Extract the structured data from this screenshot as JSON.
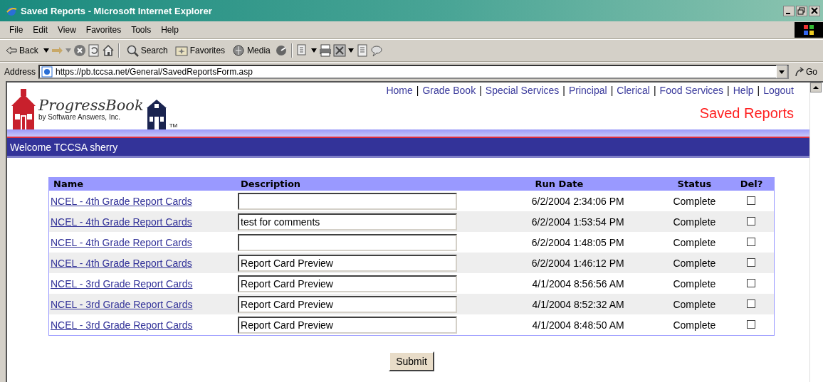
{
  "window": {
    "title": "Saved Reports - Microsoft Internet Explorer"
  },
  "menu": [
    "File",
    "Edit",
    "View",
    "Favorites",
    "Tools",
    "Help"
  ],
  "toolbar": {
    "back": "Back",
    "search": "Search",
    "favorites": "Favorites",
    "media": "Media"
  },
  "address_bar": {
    "label": "Address",
    "url": "https://pb.tccsa.net/General/SavedReportsForm.asp",
    "go": "Go"
  },
  "logo": {
    "name": "ProgressBook",
    "byline": "by Software Answers, Inc.",
    "trademark": "TM"
  },
  "nav": {
    "separator": "|",
    "links": [
      "Home",
      "Grade Book",
      "Special Services",
      "Principal",
      "Clerical",
      "Food Services",
      "Help",
      "Logout"
    ]
  },
  "page_title": "Saved Reports",
  "welcome": "Welcome TCCSA sherry",
  "table": {
    "columns": [
      "Name",
      "Description",
      "Run Date",
      "Status",
      "Del?"
    ],
    "rows": [
      {
        "name": "NCEL - 4th Grade Report Cards",
        "description": "",
        "run_date": "6/2/2004 2:34:06 PM",
        "status": "Complete",
        "checked": false
      },
      {
        "name": "NCEL - 4th Grade Report Cards",
        "description": "test for comments",
        "run_date": "6/2/2004 1:53:54 PM",
        "status": "Complete",
        "checked": false
      },
      {
        "name": "NCEL - 4th Grade Report Cards",
        "description": "",
        "run_date": "6/2/2004 1:48:05 PM",
        "status": "Complete",
        "checked": false
      },
      {
        "name": "NCEL - 4th Grade Report Cards",
        "description": "Report Card Preview",
        "run_date": "6/2/2004 1:46:12 PM",
        "status": "Complete",
        "checked": false
      },
      {
        "name": "NCEL - 3rd Grade Report Cards",
        "description": "Report Card Preview",
        "run_date": "4/1/2004 8:56:56 AM",
        "status": "Complete",
        "checked": false
      },
      {
        "name": "NCEL - 3rd Grade Report Cards",
        "description": "Report Card Preview",
        "run_date": "4/1/2004 8:52:32 AM",
        "status": "Complete",
        "checked": false
      },
      {
        "name": "NCEL - 3rd Grade Report Cards",
        "description": "Report Card Preview",
        "run_date": "4/1/2004 8:48:50 AM",
        "status": "Complete",
        "checked": false
      }
    ]
  },
  "submit": "Submit"
}
